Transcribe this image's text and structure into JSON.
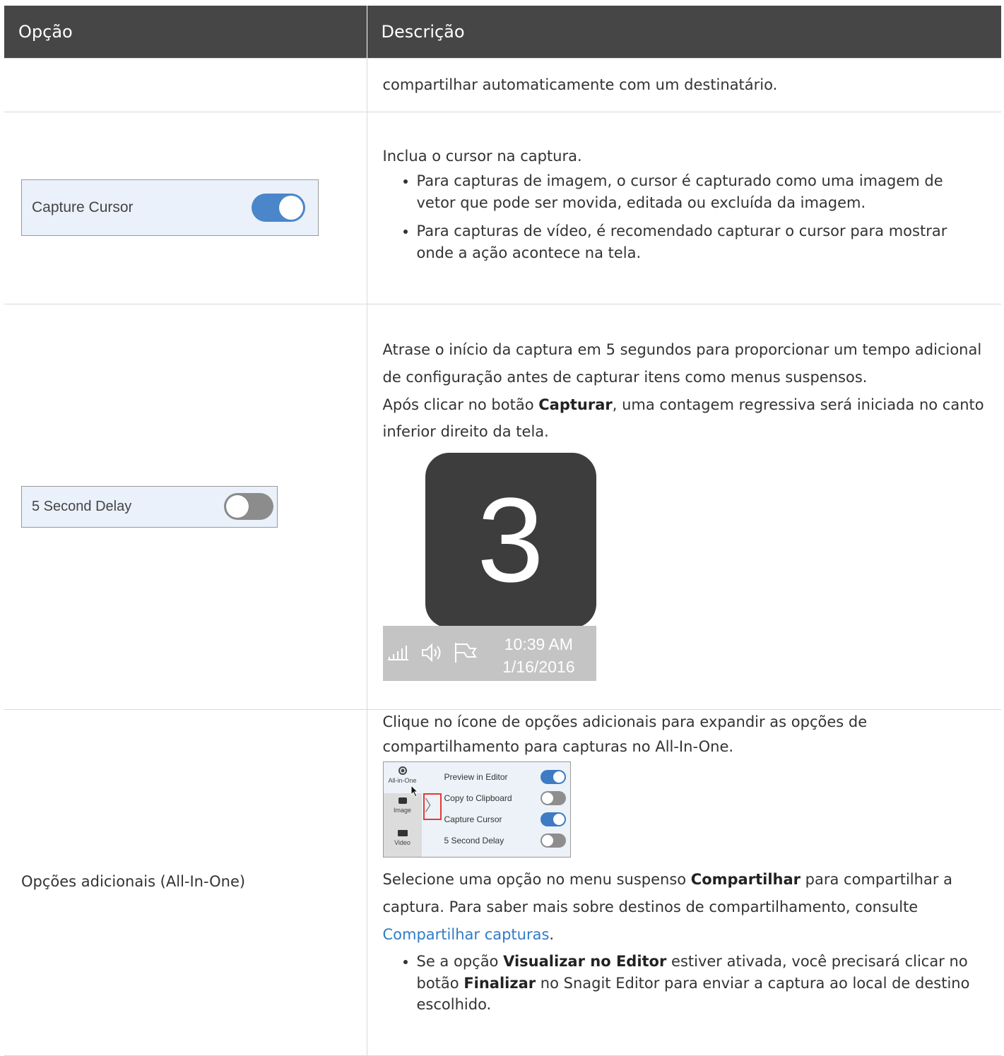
{
  "table": {
    "headers": [
      "Opção",
      "Descrição"
    ]
  },
  "rows": {
    "r0": {
      "desc": "compartilhar automaticamente com um destinatário."
    },
    "r1": {
      "widget_label": "Capture Cursor",
      "widget_toggle": "on",
      "intro": "Inclua o cursor na captura.",
      "bullets": [
        "Para capturas de imagem, o cursor é capturado como uma imagem de vetor que pode ser movida, editada ou excluída da imagem.",
        "Para capturas de vídeo, é recomendado capturar o cursor para mostrar onde a ação acontece na tela."
      ]
    },
    "r2": {
      "widget_label": "5 Second Delay",
      "widget_toggle": "off",
      "para1": "Atrase o início da captura em 5 segundos para proporcionar um tempo adicional de configuração antes de capturar itens como menus suspensos.",
      "para2_before": "Após clicar no botão ",
      "para2_bold": "Capturar",
      "para2_after": ", uma contagem regressiva será iniciada no canto inferior direito da tela.",
      "countdown_number": "3",
      "tray_time": "10:39 AM",
      "tray_date": "1/16/2016",
      "tray_icons": [
        "signal-icon",
        "speaker-icon",
        "flag-icon"
      ]
    },
    "r3": {
      "option": "Opções adicionais (All-In-One)",
      "para1": "Clique no ícone de opções adicionais para expandir as opções de compartilhamento para capturas no All-In-One.",
      "panel": {
        "modes": [
          "All-in-One",
          "Image",
          "Video"
        ],
        "options": [
          {
            "label": "Preview in Editor",
            "state": "on"
          },
          {
            "label": "Copy to Clipboard",
            "state": "off"
          },
          {
            "label": "Capture Cursor",
            "state": "on"
          },
          {
            "label": "5 Second Delay",
            "state": "off"
          }
        ],
        "arrow": "〉"
      },
      "para2_before": "Selecione uma opção no menu suspenso ",
      "para2_bold": "Compartilhar",
      "para2_mid": " para compartilhar a captura. Para saber mais sobre destinos de compartilhamento, consulte ",
      "para2_link": "Compartilhar capturas",
      "para2_after": ".",
      "bullet_1": "Se a opção ",
      "bullet_2": "Visualizar no Editor",
      "bullet_3": " estiver ativada, você precisará clicar no botão ",
      "bullet_4": "Finalizar",
      "bullet_5": " no Snagit Editor para enviar a captura ao local de destino escolhido."
    }
  },
  "colors": {
    "header_bg": "#464646",
    "link": "#2f7cc6",
    "toggle_on": "#4a86c9",
    "toggle_off": "#8c8c8c",
    "highlight_box": "#e53935"
  }
}
